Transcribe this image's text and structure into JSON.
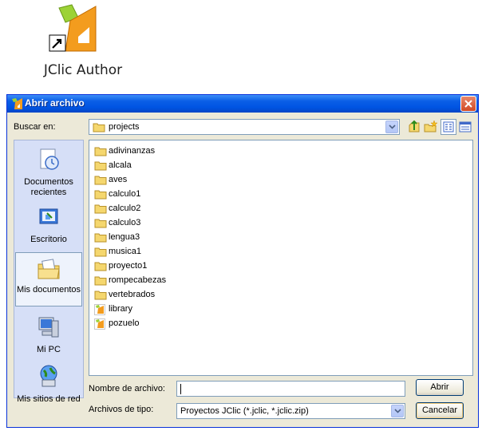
{
  "desktop": {
    "shortcut_label": "JClic Author"
  },
  "dialog": {
    "title": "Abrir archivo",
    "look_in_label": "Buscar en:",
    "look_in_value": "projects",
    "places": [
      {
        "label": "Documentos recientes",
        "icon": "recent-documents-icon"
      },
      {
        "label": "Escritorio",
        "icon": "desktop-icon"
      },
      {
        "label": "Mis documentos",
        "icon": "my-documents-icon",
        "selected": true
      },
      {
        "label": "Mi PC",
        "icon": "my-computer-icon"
      },
      {
        "label": "Mis sitios de red",
        "icon": "network-places-icon"
      }
    ],
    "files": [
      {
        "name": "adivinanzas",
        "icon": "folder-icon"
      },
      {
        "name": "alcala",
        "icon": "folder-icon"
      },
      {
        "name": "aves",
        "icon": "folder-icon"
      },
      {
        "name": "calculo1",
        "icon": "folder-icon"
      },
      {
        "name": "calculo2",
        "icon": "folder-icon"
      },
      {
        "name": "calculo3",
        "icon": "folder-icon"
      },
      {
        "name": "lengua3",
        "icon": "folder-icon"
      },
      {
        "name": "musica1",
        "icon": "folder-icon"
      },
      {
        "name": "proyecto1",
        "icon": "folder-icon"
      },
      {
        "name": "rompecabezas",
        "icon": "folder-icon"
      },
      {
        "name": "vertebrados",
        "icon": "folder-icon"
      },
      {
        "name": "library",
        "icon": "jclic-project-icon"
      },
      {
        "name": "pozuelo",
        "icon": "jclic-project-icon"
      }
    ],
    "file_name_label": "Nombre de archivo:",
    "file_name_value": "",
    "file_type_label": "Archivos de tipo:",
    "file_type_value": "Proyectos JClic (*.jclic, *.jclic.zip)",
    "open_button": "Abrir",
    "cancel_button": "Cancelar"
  },
  "colors": {
    "titlebar": "#0054e3",
    "dialog_bg": "#ece9d8",
    "places_bg": "#d6dff7",
    "folder": "#f5d76e",
    "close_button": "#d14925"
  }
}
